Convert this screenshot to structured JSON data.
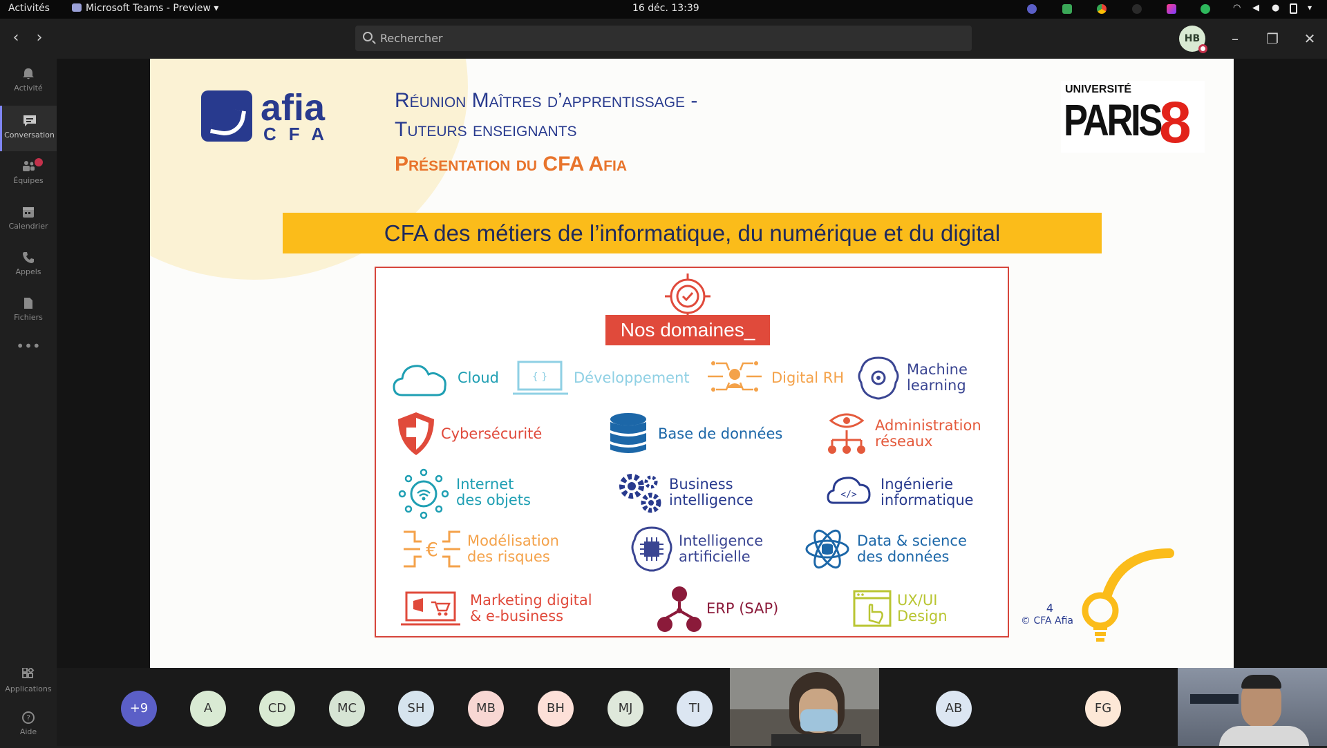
{
  "topbar": {
    "activities": "Activités",
    "app_name": "Microsoft Teams - Preview",
    "datetime": "16 déc.  13:39"
  },
  "titlebar": {
    "search_placeholder": "Rechercher",
    "user_initials": "HB"
  },
  "rail": {
    "items": [
      {
        "label": "Activité",
        "icon": "bell-icon"
      },
      {
        "label": "Conversation",
        "icon": "chat-icon"
      },
      {
        "label": "Équipes",
        "icon": "teams-icon"
      },
      {
        "label": "Calendrier",
        "icon": "calendar-icon"
      },
      {
        "label": "Appels",
        "icon": "phone-icon"
      },
      {
        "label": "Fichiers",
        "icon": "files-icon"
      }
    ],
    "bottom": [
      {
        "label": "Applications",
        "icon": "apps-icon"
      },
      {
        "label": "Aide",
        "icon": "help-icon"
      }
    ]
  },
  "slide": {
    "logo_name": "afia",
    "logo_sub": "CFA",
    "title_line1": "Réunion Maîtres d’apprentissage -",
    "title_line2": "Tuteurs enseignants",
    "subtitle": "Présentation du CFA Afia",
    "partner_univ": "UNIVERSITÉ",
    "partner_city": "PARIS",
    "partner_num": "8",
    "banner": "CFA des métiers de l’informatique, du numérique et du digital",
    "domains_title": "Nos domaines_",
    "domains": [
      {
        "label": "Cloud",
        "icon": "cloud-icon",
        "color": "#1f9fb3"
      },
      {
        "label": "Développement",
        "icon": "laptop-code-icon",
        "color": "#8fd0e4"
      },
      {
        "label": "Digital RH",
        "icon": "network-people-icon",
        "color": "#f4a24a"
      },
      {
        "label": "Machine learning",
        "icon": "brain-gear-icon",
        "color": "#3a4592"
      },
      {
        "label": "Cybersécurité",
        "icon": "shield-icon",
        "color": "#e04a3b"
      },
      {
        "label": "Base de données",
        "icon": "database-icon",
        "color": "#1c67a8"
      },
      {
        "label": "Administration réseaux",
        "icon": "eye-network-icon",
        "color": "#e45a3c"
      },
      {
        "label": "Internet des objets",
        "icon": "iot-icon",
        "color": "#1f9fb3"
      },
      {
        "label": "Business intelligence",
        "icon": "gears-icon",
        "color": "#283a8e"
      },
      {
        "label": "Ingénierie informatique",
        "icon": "code-cloud-icon",
        "color": "#283a8e"
      },
      {
        "label": "Modélisation des risques",
        "icon": "euro-network-icon",
        "color": "#f4a24a"
      },
      {
        "label": "Intelligence artificielle",
        "icon": "chip-brain-icon",
        "color": "#3a4592"
      },
      {
        "label": "Data & science des données",
        "icon": "atom-db-icon",
        "color": "#1c67a8"
      },
      {
        "label": "Marketing digital & e-business",
        "icon": "laptop-cart-icon",
        "color": "#e04a3b"
      },
      {
        "label": "ERP (SAP)",
        "icon": "org-icon",
        "color": "#8b1a3a"
      },
      {
        "label": "UX/UI Design",
        "icon": "browser-hand-icon",
        "color": "#b9c532"
      }
    ],
    "page_number": "4",
    "copyright": "© CFA Afia"
  },
  "participants": {
    "overflow": "+9",
    "avatars": [
      {
        "initials": "A",
        "color": "#d9ead3"
      },
      {
        "initials": "CD",
        "color": "#d9ead3"
      },
      {
        "initials": "MC",
        "color": "#d6e4d4"
      },
      {
        "initials": "SH",
        "color": "#d6e4ee"
      },
      {
        "initials": "MB",
        "color": "#f8d7d3"
      },
      {
        "initials": "BH",
        "color": "#fde0d8"
      },
      {
        "initials": "MJ",
        "color": "#dfe8db"
      },
      {
        "initials": "TI",
        "color": "#dce6f2"
      },
      {
        "initials": "AB",
        "color": "#dce6f2"
      },
      {
        "initials": "FG",
        "color": "#fde8d7"
      }
    ]
  }
}
